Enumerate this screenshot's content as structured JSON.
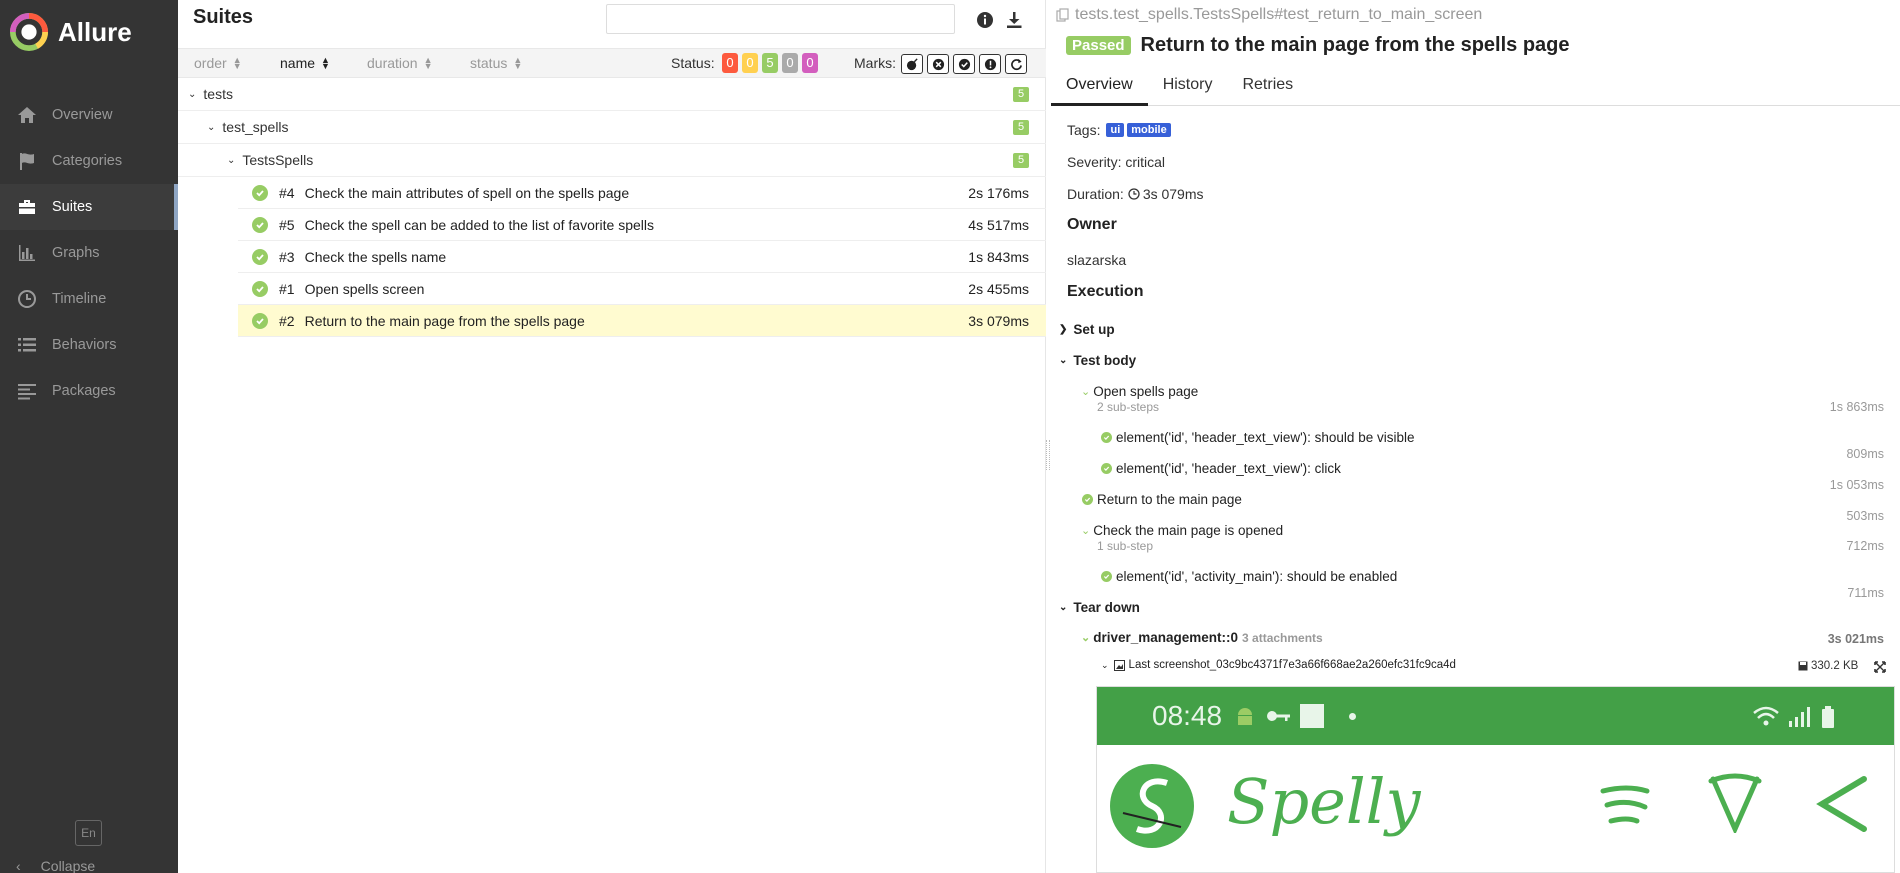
{
  "app": {
    "name": "Allure"
  },
  "sidebar": {
    "items": [
      {
        "label": "Overview",
        "icon": "home-icon"
      },
      {
        "label": "Categories",
        "icon": "flag-icon"
      },
      {
        "label": "Suites",
        "icon": "briefcase-icon",
        "active": true
      },
      {
        "label": "Graphs",
        "icon": "bar-chart-icon"
      },
      {
        "label": "Timeline",
        "icon": "clock-icon"
      },
      {
        "label": "Behaviors",
        "icon": "list-icon"
      },
      {
        "label": "Packages",
        "icon": "align-left-icon"
      }
    ],
    "language": "En",
    "collapse_label": "Collapse"
  },
  "suites": {
    "title": "Suites",
    "search_value": "",
    "sort": {
      "order": "order",
      "name": "name",
      "duration": "duration",
      "status": "status"
    },
    "status_label": "Status:",
    "status_counts": [
      {
        "value": "0",
        "color": "#fd5a3e"
      },
      {
        "value": "0",
        "color": "#ffd050"
      },
      {
        "value": "5",
        "color": "#97cc64"
      },
      {
        "value": "0",
        "color": "#aaaaaa"
      },
      {
        "value": "0",
        "color": "#d35ebe"
      }
    ],
    "marks_label": "Marks:",
    "groups": [
      {
        "label": "tests",
        "count": "5"
      },
      {
        "label": "test_spells",
        "count": "5"
      },
      {
        "label": "TestsSpells",
        "count": "5"
      }
    ],
    "rows": [
      {
        "num": "#4",
        "name": "Check the main attributes of spell on the spells page",
        "duration": "2s 176ms"
      },
      {
        "num": "#5",
        "name": "Check the spell can be added to the list of favorite spells",
        "duration": "4s 517ms"
      },
      {
        "num": "#3",
        "name": "Check the spells name",
        "duration": "1s 843ms"
      },
      {
        "num": "#1",
        "name": "Open spells screen",
        "duration": "2s 455ms"
      },
      {
        "num": "#2",
        "name": "Return to the main page from the spells page",
        "duration": "3s 079ms",
        "selected": true
      }
    ]
  },
  "test": {
    "full_name": "tests.test_spells.TestsSpells#test_return_to_main_screen",
    "status": "Passed",
    "name": "Return to the main page from the spells page",
    "tabs": [
      "Overview",
      "History",
      "Retries"
    ],
    "tags_label": "Tags:",
    "tags": [
      "ui",
      "mobile"
    ],
    "severity": "Severity: critical",
    "duration_label": "Duration:",
    "duration": "3s 079ms",
    "owner_heading": "Owner",
    "owner": "slazarska",
    "execution_heading": "Execution",
    "setup": "Set up",
    "test_body": "Test body",
    "steps": {
      "open_spells": "Open spells page",
      "open_spells_sub": "2 sub-steps",
      "open_spells_time": "1s 863ms",
      "s1": "element('id', 'header_text_view'): should be visible",
      "s1_time": "809ms",
      "s2": "element('id', 'header_text_view'): click",
      "s2_time": "1s 053ms",
      "ret_main": "Return to the main page",
      "ret_main_time": "503ms",
      "check_main": "Check the main page is opened",
      "check_main_sub": "1 sub-step",
      "check_main_time": "712ms",
      "s3": "element('id', 'activity_main'): should be enabled",
      "s3_time": "711ms"
    },
    "teardown": "Tear down",
    "fixture": "driver_management::0",
    "fixture_attachments": "3 attachments",
    "fixture_time": "3s 021ms",
    "attachment_name": "Last screenshot_03c9bc4371f7e3a66f668ae2a260efc31fc9ca4d",
    "attachment_size": "330.2 KB",
    "screenshot": {
      "clock": "08:48",
      "app_title": "Spelly"
    }
  }
}
